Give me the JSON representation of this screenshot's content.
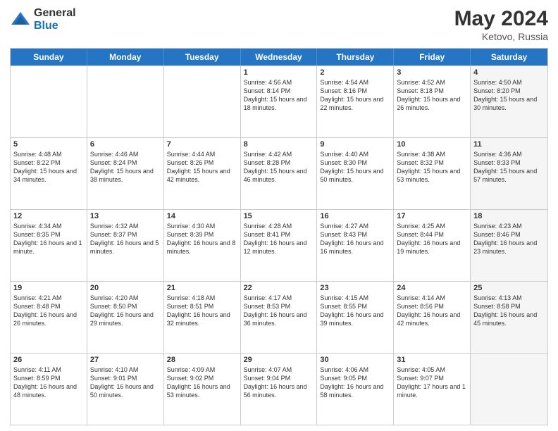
{
  "header": {
    "logo_general": "General",
    "logo_blue": "Blue",
    "title": "May 2024",
    "location": "Ketovo, Russia"
  },
  "days_of_week": [
    "Sunday",
    "Monday",
    "Tuesday",
    "Wednesday",
    "Thursday",
    "Friday",
    "Saturday"
  ],
  "weeks": [
    [
      {
        "num": "",
        "sunrise": "",
        "sunset": "",
        "daylight": "",
        "shaded": false
      },
      {
        "num": "",
        "sunrise": "",
        "sunset": "",
        "daylight": "",
        "shaded": false
      },
      {
        "num": "",
        "sunrise": "",
        "sunset": "",
        "daylight": "",
        "shaded": false
      },
      {
        "num": "1",
        "sunrise": "Sunrise: 4:56 AM",
        "sunset": "Sunset: 8:14 PM",
        "daylight": "Daylight: 15 hours and 18 minutes.",
        "shaded": false
      },
      {
        "num": "2",
        "sunrise": "Sunrise: 4:54 AM",
        "sunset": "Sunset: 8:16 PM",
        "daylight": "Daylight: 15 hours and 22 minutes.",
        "shaded": false
      },
      {
        "num": "3",
        "sunrise": "Sunrise: 4:52 AM",
        "sunset": "Sunset: 8:18 PM",
        "daylight": "Daylight: 15 hours and 26 minutes.",
        "shaded": false
      },
      {
        "num": "4",
        "sunrise": "Sunrise: 4:50 AM",
        "sunset": "Sunset: 8:20 PM",
        "daylight": "Daylight: 15 hours and 30 minutes.",
        "shaded": true
      }
    ],
    [
      {
        "num": "5",
        "sunrise": "Sunrise: 4:48 AM",
        "sunset": "Sunset: 8:22 PM",
        "daylight": "Daylight: 15 hours and 34 minutes.",
        "shaded": false
      },
      {
        "num": "6",
        "sunrise": "Sunrise: 4:46 AM",
        "sunset": "Sunset: 8:24 PM",
        "daylight": "Daylight: 15 hours and 38 minutes.",
        "shaded": false
      },
      {
        "num": "7",
        "sunrise": "Sunrise: 4:44 AM",
        "sunset": "Sunset: 8:26 PM",
        "daylight": "Daylight: 15 hours and 42 minutes.",
        "shaded": false
      },
      {
        "num": "8",
        "sunrise": "Sunrise: 4:42 AM",
        "sunset": "Sunset: 8:28 PM",
        "daylight": "Daylight: 15 hours and 46 minutes.",
        "shaded": false
      },
      {
        "num": "9",
        "sunrise": "Sunrise: 4:40 AM",
        "sunset": "Sunset: 8:30 PM",
        "daylight": "Daylight: 15 hours and 50 minutes.",
        "shaded": false
      },
      {
        "num": "10",
        "sunrise": "Sunrise: 4:38 AM",
        "sunset": "Sunset: 8:32 PM",
        "daylight": "Daylight: 15 hours and 53 minutes.",
        "shaded": false
      },
      {
        "num": "11",
        "sunrise": "Sunrise: 4:36 AM",
        "sunset": "Sunset: 8:33 PM",
        "daylight": "Daylight: 15 hours and 57 minutes.",
        "shaded": true
      }
    ],
    [
      {
        "num": "12",
        "sunrise": "Sunrise: 4:34 AM",
        "sunset": "Sunset: 8:35 PM",
        "daylight": "Daylight: 16 hours and 1 minute.",
        "shaded": false
      },
      {
        "num": "13",
        "sunrise": "Sunrise: 4:32 AM",
        "sunset": "Sunset: 8:37 PM",
        "daylight": "Daylight: 16 hours and 5 minutes.",
        "shaded": false
      },
      {
        "num": "14",
        "sunrise": "Sunrise: 4:30 AM",
        "sunset": "Sunset: 8:39 PM",
        "daylight": "Daylight: 16 hours and 8 minutes.",
        "shaded": false
      },
      {
        "num": "15",
        "sunrise": "Sunrise: 4:28 AM",
        "sunset": "Sunset: 8:41 PM",
        "daylight": "Daylight: 16 hours and 12 minutes.",
        "shaded": false
      },
      {
        "num": "16",
        "sunrise": "Sunrise: 4:27 AM",
        "sunset": "Sunset: 8:43 PM",
        "daylight": "Daylight: 16 hours and 16 minutes.",
        "shaded": false
      },
      {
        "num": "17",
        "sunrise": "Sunrise: 4:25 AM",
        "sunset": "Sunset: 8:44 PM",
        "daylight": "Daylight: 16 hours and 19 minutes.",
        "shaded": false
      },
      {
        "num": "18",
        "sunrise": "Sunrise: 4:23 AM",
        "sunset": "Sunset: 8:46 PM",
        "daylight": "Daylight: 16 hours and 23 minutes.",
        "shaded": true
      }
    ],
    [
      {
        "num": "19",
        "sunrise": "Sunrise: 4:21 AM",
        "sunset": "Sunset: 8:48 PM",
        "daylight": "Daylight: 16 hours and 26 minutes.",
        "shaded": false
      },
      {
        "num": "20",
        "sunrise": "Sunrise: 4:20 AM",
        "sunset": "Sunset: 8:50 PM",
        "daylight": "Daylight: 16 hours and 29 minutes.",
        "shaded": false
      },
      {
        "num": "21",
        "sunrise": "Sunrise: 4:18 AM",
        "sunset": "Sunset: 8:51 PM",
        "daylight": "Daylight: 16 hours and 32 minutes.",
        "shaded": false
      },
      {
        "num": "22",
        "sunrise": "Sunrise: 4:17 AM",
        "sunset": "Sunset: 8:53 PM",
        "daylight": "Daylight: 16 hours and 36 minutes.",
        "shaded": false
      },
      {
        "num": "23",
        "sunrise": "Sunrise: 4:15 AM",
        "sunset": "Sunset: 8:55 PM",
        "daylight": "Daylight: 16 hours and 39 minutes.",
        "shaded": false
      },
      {
        "num": "24",
        "sunrise": "Sunrise: 4:14 AM",
        "sunset": "Sunset: 8:56 PM",
        "daylight": "Daylight: 16 hours and 42 minutes.",
        "shaded": false
      },
      {
        "num": "25",
        "sunrise": "Sunrise: 4:13 AM",
        "sunset": "Sunset: 8:58 PM",
        "daylight": "Daylight: 16 hours and 45 minutes.",
        "shaded": true
      }
    ],
    [
      {
        "num": "26",
        "sunrise": "Sunrise: 4:11 AM",
        "sunset": "Sunset: 8:59 PM",
        "daylight": "Daylight: 16 hours and 48 minutes.",
        "shaded": false
      },
      {
        "num": "27",
        "sunrise": "Sunrise: 4:10 AM",
        "sunset": "Sunset: 9:01 PM",
        "daylight": "Daylight: 16 hours and 50 minutes.",
        "shaded": false
      },
      {
        "num": "28",
        "sunrise": "Sunrise: 4:09 AM",
        "sunset": "Sunset: 9:02 PM",
        "daylight": "Daylight: 16 hours and 53 minutes.",
        "shaded": false
      },
      {
        "num": "29",
        "sunrise": "Sunrise: 4:07 AM",
        "sunset": "Sunset: 9:04 PM",
        "daylight": "Daylight: 16 hours and 56 minutes.",
        "shaded": false
      },
      {
        "num": "30",
        "sunrise": "Sunrise: 4:06 AM",
        "sunset": "Sunset: 9:05 PM",
        "daylight": "Daylight: 16 hours and 58 minutes.",
        "shaded": false
      },
      {
        "num": "31",
        "sunrise": "Sunrise: 4:05 AM",
        "sunset": "Sunset: 9:07 PM",
        "daylight": "Daylight: 17 hours and 1 minute.",
        "shaded": false
      },
      {
        "num": "",
        "sunrise": "",
        "sunset": "",
        "daylight": "",
        "shaded": true
      }
    ]
  ]
}
